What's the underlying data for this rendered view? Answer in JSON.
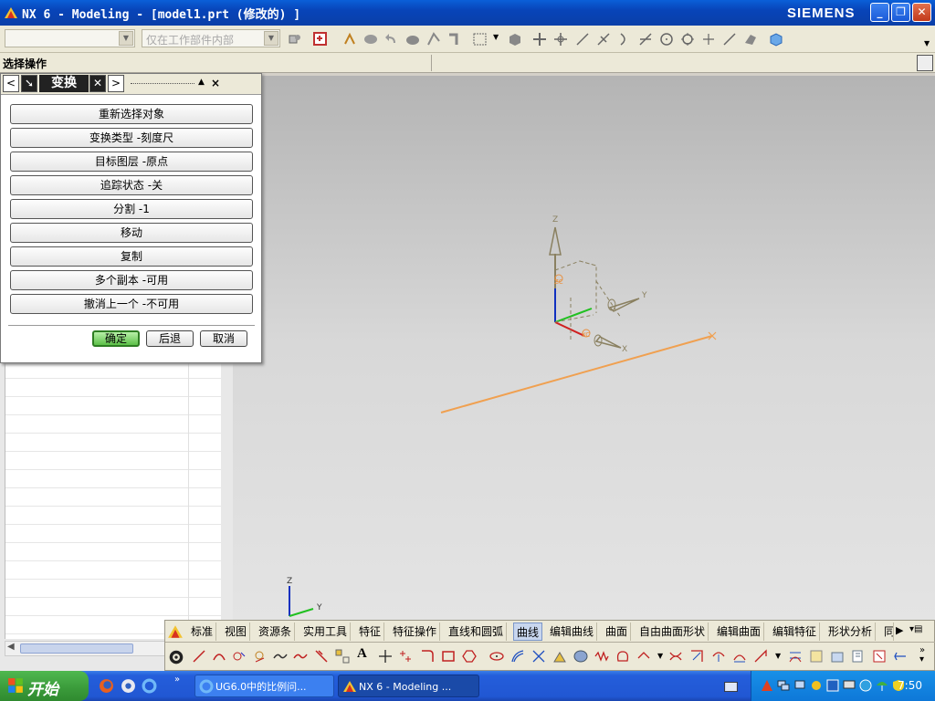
{
  "window": {
    "title": "NX 6 - Modeling - [model1.prt (修改的) ]",
    "brand": "SIEMENS",
    "minimize": "_",
    "restore": "❐",
    "close": "✕"
  },
  "toolbar": {
    "filter_combo_value": "",
    "scope_combo_value": "仅在工作部件内部"
  },
  "select_bar": {
    "label": "选择操作"
  },
  "dialog": {
    "title": "变换",
    "prev": "<",
    "next": ">",
    "close_label": "✕",
    "options": [
      "重新选择对象",
      "变换类型 -刻度尺",
      "目标图层 -原点",
      "追踪状态 -关",
      "分割 -1",
      "移动",
      "复制",
      "多个副本 -可用",
      "撤消上一个 -不可用"
    ],
    "ok": "确定",
    "back": "后退",
    "cancel": "取消"
  },
  "viewport": {
    "wcs_labels": {
      "z": "Z",
      "y": "Y",
      "x": "X",
      "zc": "ZC",
      "xc": "XC"
    },
    "triad_labels": {
      "z": "Z",
      "y": "Y"
    },
    "line_color": "#f0a050"
  },
  "curve_toolbar": {
    "tabs": [
      "标准",
      "视图",
      "资源条",
      "实用工具",
      "特征",
      "特征操作",
      "直线和圆弧",
      "曲线",
      "编辑曲线",
      "曲面",
      "自由曲面形状",
      "编辑曲面",
      "编辑特征",
      "形状分析",
      "同"
    ],
    "active_tab": "曲线",
    "more": "▶",
    "text_icon": "A"
  },
  "taskbar": {
    "start": "开始",
    "tasks": [
      "UG6.0中的比例问...",
      "NX 6 - Modeling ..."
    ],
    "clock": "7:50"
  }
}
